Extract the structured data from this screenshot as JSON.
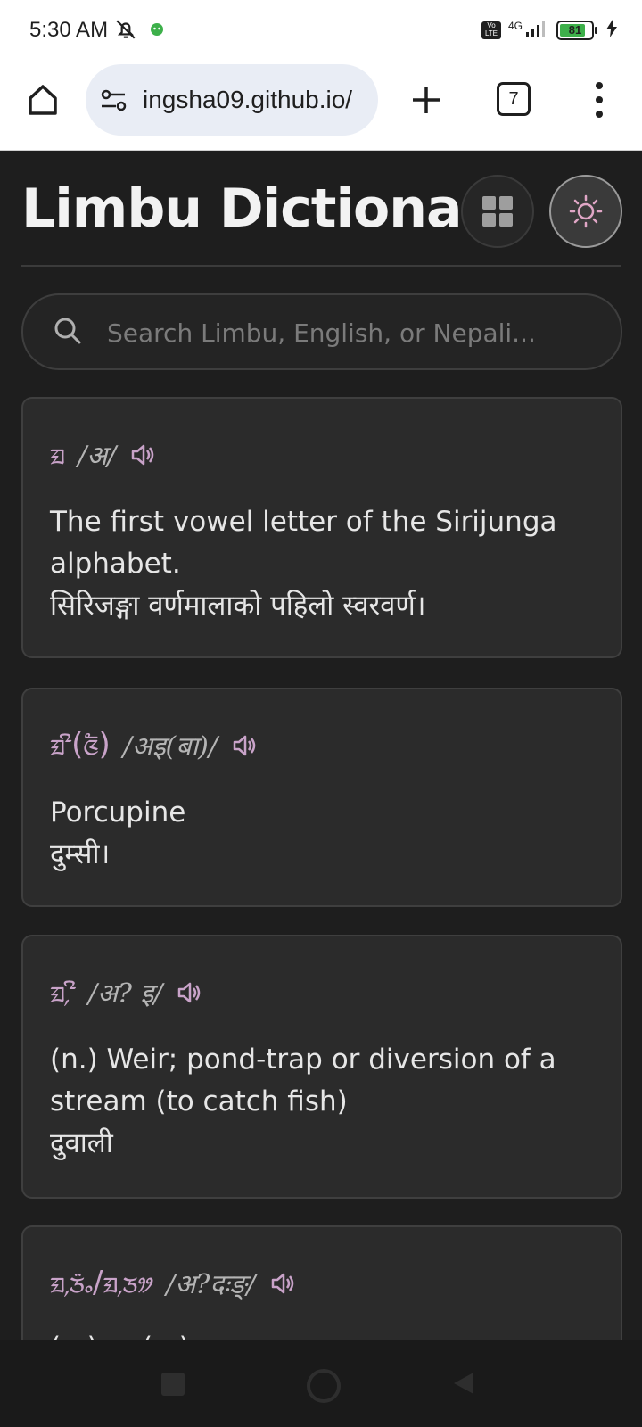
{
  "status_bar": {
    "time": "5:30 AM",
    "network": "4G",
    "volte": "Vo LTE",
    "battery": "81",
    "battery_level": 0.81
  },
  "browser": {
    "url": "ingsha09.github.io/",
    "tab_count": "7"
  },
  "header": {
    "title": "Limbu Dictionary"
  },
  "search": {
    "placeholder": "Search Limbu, English, or Nepali...",
    "value": ""
  },
  "entries": [
    {
      "limbu": "ᤀ",
      "pronunciation": "/अ/",
      "definition_lines": [
        "The first vowel letter of the Sirijunga",
        "alphabet.",
        "सिरिजङ्गा वर्णमालाको पहिलो स्वरवर्ण।"
      ]
    },
    {
      "limbu": "ᤀᤡ(ᤜᤠ)",
      "pronunciation": "/अइ(बा)/",
      "definition_lines": [
        "Porcupine",
        "दुम्सी।"
      ]
    },
    {
      "limbu": "ᤀ᤹ᤡ",
      "pronunciation": "/अ? इ/",
      "definition_lines": [
        "(n.) Weir; pond-trap or diversion of a",
        "stream (to catch fish)",
        "दुवाली"
      ]
    },
    {
      "limbu": "ᤀ᤹ᤍ᤺ᤱ/ᤀ᤹ᤍᤤ",
      "pronunciation": "/अ?दःङ्/",
      "definition_lines": [
        "(n.) ... (...) ..."
      ]
    }
  ],
  "colors": {
    "page_bg": "#1e1e1e",
    "card_bg": "#2b2b2b",
    "limbu_accent": "#c9a3c9",
    "text": "#e6e6e6"
  },
  "icons": [
    "home-icon",
    "tune-icon",
    "plus-icon",
    "tabs-icon",
    "more-vert-icon",
    "grid-icon",
    "sun-icon",
    "search-icon",
    "speaker-icon"
  ]
}
